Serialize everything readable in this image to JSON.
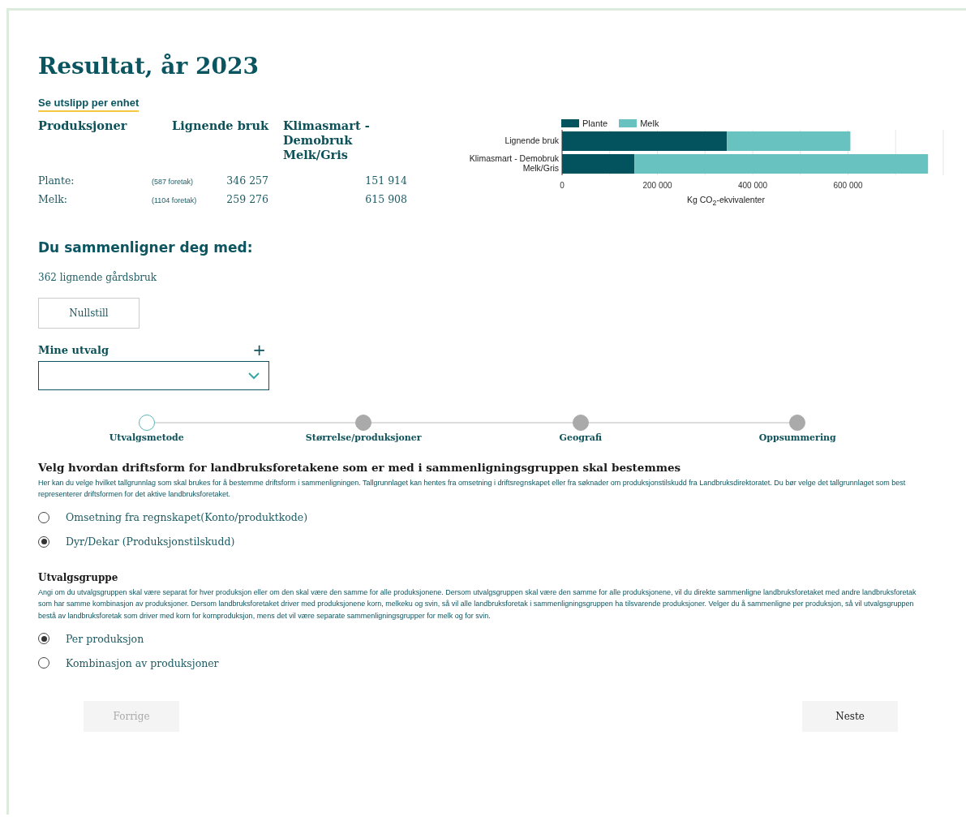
{
  "title": "Resultat, år 2023",
  "unit_link": "Se utslipp per enhet",
  "table": {
    "columns": [
      "Produksjoner",
      "Lignende bruk",
      "Klimasmart - Demobruk Melk/Gris"
    ],
    "rows": [
      {
        "label": "Plante:",
        "count": "(587 foretak)",
        "similar": "346 257",
        "own": "151 914"
      },
      {
        "label": "Melk:",
        "count": "(1104 foretak)",
        "similar": "259 276",
        "own": "615 908"
      }
    ]
  },
  "chart_data": {
    "type": "bar",
    "orientation": "horizontal",
    "stacked": true,
    "xlabel": "Kg CO$_{2}$-ekvivalenter",
    "categories": [
      "Lignende bruk",
      "Klimasmart - Demobruk Melk/Gris"
    ],
    "series": [
      {
        "name": "Plante",
        "color": "#02535e",
        "values": [
          346000,
          152000
        ]
      },
      {
        "name": "Melk",
        "color": "#67c2c0",
        "values": [
          259000,
          616000
        ]
      }
    ],
    "legend": true,
    "grid": true,
    "xlim": [
      0,
      800000
    ],
    "xticks": [
      {
        "value": 0,
        "label": "0"
      },
      {
        "value": 200000,
        "label": "200 000"
      },
      {
        "value": 400000,
        "label": "400 000"
      },
      {
        "value": 600000,
        "label": "600 000"
      }
    ]
  },
  "compare": {
    "heading": "Du sammenligner deg med:",
    "count": "362 lignende gårdsbruk",
    "reset": "Nullstill",
    "selections_label": "Mine utvalg",
    "add": "+"
  },
  "steps": [
    {
      "label": "Utvalgsmetode",
      "selected": true
    },
    {
      "label": "Størrelse/produksjoner",
      "selected": false
    },
    {
      "label": "Geografi",
      "selected": false
    },
    {
      "label": "Oppsummering",
      "selected": false
    }
  ],
  "sections": [
    {
      "heading": "Velg hvordan driftsform for landbruksforetakene som er med i sammenligningsgruppen skal bestemmes",
      "big": true,
      "text": "Her kan du velge hvilket tallgrunnlag som skal brukes for å bestemme driftsform i sammenligningen. Tallgrunnlaget kan hentes fra omsetning i driftsregnskapet eller fra søknader om produksjonstilskudd fra Landbruksdirektoratet. Du bør velge det tallgrunnlaget som best representerer driftsformen for det aktive landbruksforetaket.",
      "options": [
        {
          "label": "Omsetning fra regnskapet(Konto/produktkode)",
          "selected": false
        },
        {
          "label": "Dyr/Dekar (Produksjonstilskudd)",
          "selected": true
        }
      ]
    },
    {
      "heading": "Utvalgsgruppe",
      "big": false,
      "text": "Angi om du utvalgsgruppen skal være separat for hver produksjon eller om den skal være den samme for alle produksjonene. Dersom utvalgsgruppen skal være den samme for alle produksjonene, vil du direkte sammenligne landbruksforetaket med andre landbruksforetak som har samme kombinasjon av produksjoner. Dersom landbruksforetaket driver med produksjonene korn, melkeku og svin, så vil alle landbruksforetak i sammenligningsgruppen ha tilsvarende produksjoner. Velger du å sammenligne per produksjon, så vil utvalgsgruppen bestå av landbruksforetak som driver med korn for kornproduksjon, mens det vil være separate sammenligningsgrupper for melk og for svin.",
      "options": [
        {
          "label": "Per produksjon",
          "selected": true
        },
        {
          "label": "Kombinasjon av produksjoner",
          "selected": false
        }
      ]
    }
  ],
  "nav": {
    "prev": {
      "label": "Forrige",
      "disabled": true
    },
    "next": {
      "label": "Neste",
      "disabled": false
    }
  }
}
